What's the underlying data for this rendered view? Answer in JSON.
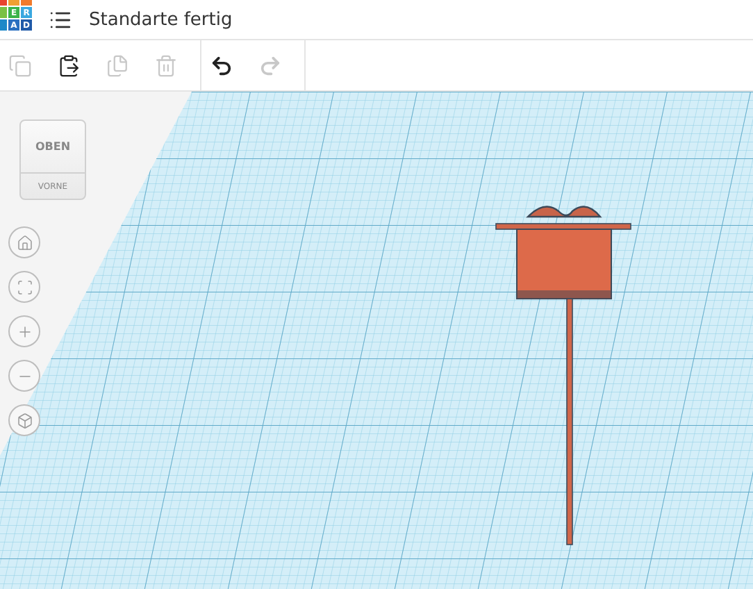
{
  "header": {
    "logo": [
      {
        "color": "#e8442e"
      },
      {
        "color": "#f0a033"
      },
      {
        "color": "#f07a2c"
      },
      {
        "color": "#7ac143"
      },
      {
        "letter": "E",
        "color": "#3bb34a"
      },
      {
        "letter": "R",
        "color": "#3aa8e0"
      },
      {
        "color": "#1e88c8"
      },
      {
        "letter": "A",
        "color": "#2a6fc0"
      },
      {
        "letter": "D",
        "color": "#1f5aa8"
      }
    ],
    "title": "Standarte fertig"
  },
  "toolbar": [
    {
      "kind": "copy",
      "disabled": true
    },
    {
      "kind": "paste",
      "disabled": false
    },
    {
      "kind": "duplicate",
      "disabled": true
    },
    {
      "kind": "delete",
      "disabled": true
    },
    {
      "kind": "undo",
      "disabled": false
    },
    {
      "kind": "redo",
      "disabled": true
    }
  ],
  "view_cube": {
    "top": "OBEN",
    "front": "VORNE"
  },
  "view_controls": [
    {
      "kind": "home"
    },
    {
      "kind": "fit"
    },
    {
      "kind": "zoom-in"
    },
    {
      "kind": "zoom-out"
    },
    {
      "kind": "perspective"
    }
  ]
}
